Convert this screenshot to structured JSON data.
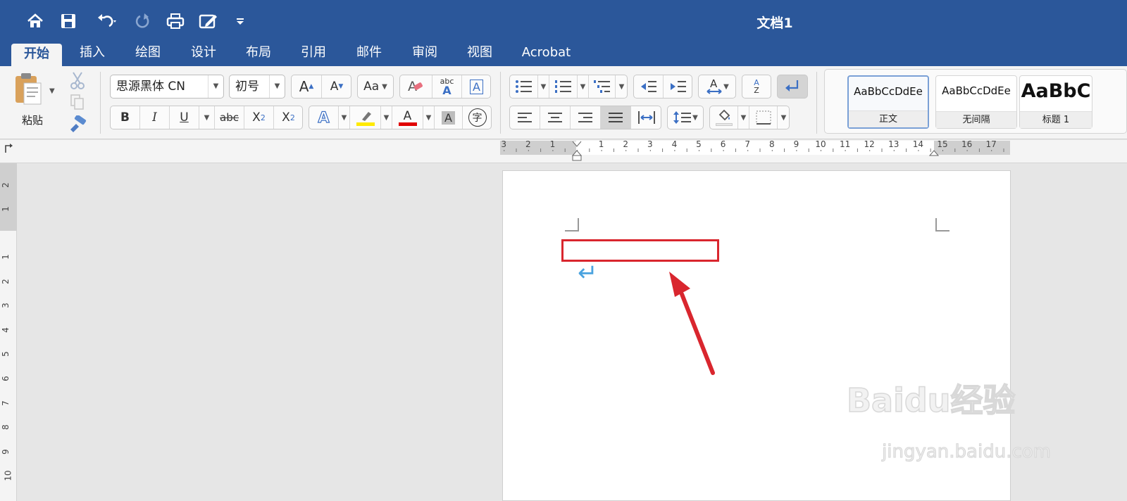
{
  "window": {
    "title": "文档1"
  },
  "quick_access": {
    "icons": [
      "home-icon",
      "save-icon",
      "undo-icon",
      "redo-icon",
      "print-icon",
      "edit-doc-icon",
      "customize-icon"
    ]
  },
  "tabs": [
    {
      "label": "开始"
    },
    {
      "label": "插入"
    },
    {
      "label": "绘图"
    },
    {
      "label": "设计"
    },
    {
      "label": "布局"
    },
    {
      "label": "引用"
    },
    {
      "label": "邮件"
    },
    {
      "label": "审阅"
    },
    {
      "label": "视图"
    },
    {
      "label": "Acrobat"
    }
  ],
  "clipboard": {
    "paste_label": "粘贴"
  },
  "font": {
    "family": "思源黑体 CN",
    "size": "初号",
    "grow": "A",
    "shrink": "A",
    "change_case": "Aa",
    "clear": "A",
    "phonetic_top": "abc",
    "phonetic_bottom": "A",
    "char_border": "A",
    "bold": "B",
    "italic": "I",
    "underline": "U",
    "strikethrough": "abc",
    "subscript": "X",
    "sub_mark": "2",
    "superscript": "X",
    "sup_mark": "2",
    "text_effects": "A",
    "font_color": "A",
    "char_shading": "A",
    "enclose": "字"
  },
  "paragraph": {
    "sort_top": "A",
    "sort_bottom": "Z"
  },
  "styles": [
    {
      "sample": "AaBbCcDdEe",
      "label": "正文"
    },
    {
      "sample": "AaBbCcDdEe",
      "label": "无间隔"
    },
    {
      "sample": "AaBbC",
      "label": "标题 1"
    }
  ],
  "ruler": {
    "top_left_labels": [
      "3",
      "2",
      "1"
    ],
    "top_right_labels": [
      "1",
      "2",
      "3",
      "4",
      "5",
      "6",
      "7",
      "8",
      "9",
      "10",
      "11",
      "12",
      "13",
      "14",
      "15",
      "16",
      "17"
    ],
    "side_labels": [
      "2",
      "1",
      "1",
      "2",
      "3",
      "4",
      "5",
      "6",
      "7",
      "8",
      "9",
      "10"
    ]
  },
  "document": {
    "paragraph_mark": "↵"
  },
  "colors": {
    "brand": "#2b579a",
    "highlight": "#ffea00",
    "font_color": "#e00000",
    "annotation": "#d9262e"
  },
  "watermark": {
    "brand": "Baidu经验",
    "url": "jingyan.baidu.com"
  }
}
